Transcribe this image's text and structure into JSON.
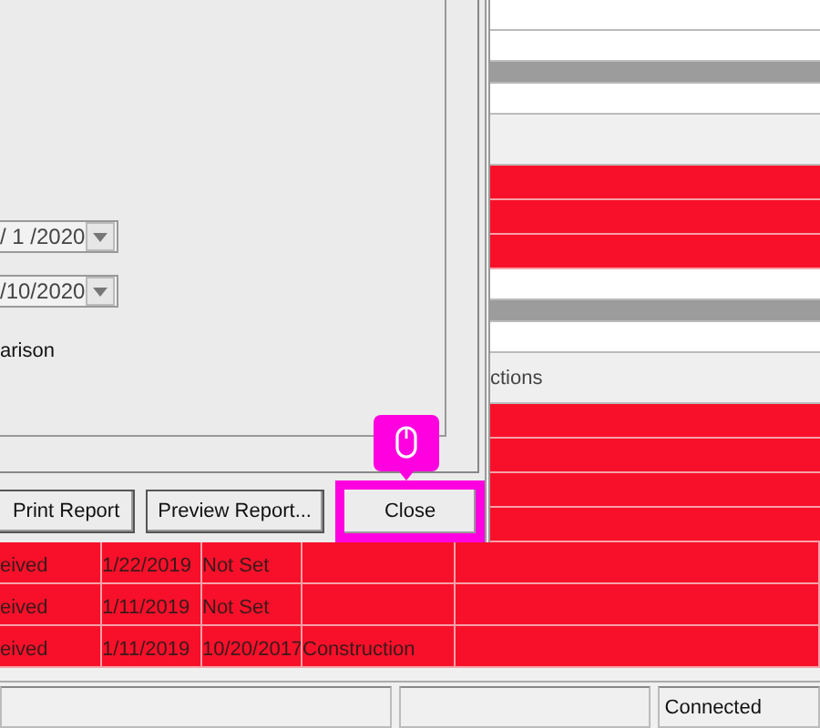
{
  "dialog": {
    "date_fields": [
      {
        "value": "/ 1 /2020"
      },
      {
        "value": "/10/2020"
      }
    ],
    "option_label": "arison",
    "buttons": [
      {
        "label": "Print Report",
        "highlighted": false
      },
      {
        "label": "Preview Report...",
        "highlighted": false
      },
      {
        "label": "Close",
        "highlighted": true
      }
    ]
  },
  "grid_rows": [
    {
      "kind": "blank"
    },
    {
      "kind": "blank"
    },
    {
      "kind": "band"
    },
    {
      "kind": "blank"
    },
    {
      "kind": "shaded"
    },
    {
      "kind": "red"
    },
    {
      "kind": "red"
    },
    {
      "kind": "red"
    },
    {
      "kind": "blank"
    },
    {
      "kind": "band"
    },
    {
      "kind": "blank"
    },
    {
      "kind": "header",
      "text": "ctions"
    },
    {
      "kind": "red"
    },
    {
      "kind": "red"
    },
    {
      "kind": "red"
    },
    {
      "kind": "red"
    }
  ],
  "table": {
    "rows": [
      [
        "eived",
        "1/22/2019",
        "Not Set"
      ],
      [
        "eived",
        "1/11/2019",
        "Not Set"
      ],
      [
        "eived",
        "1/11/2019",
        "10/20/2017",
        "Construction"
      ]
    ]
  },
  "status_bar": {
    "connection": "Connected"
  }
}
